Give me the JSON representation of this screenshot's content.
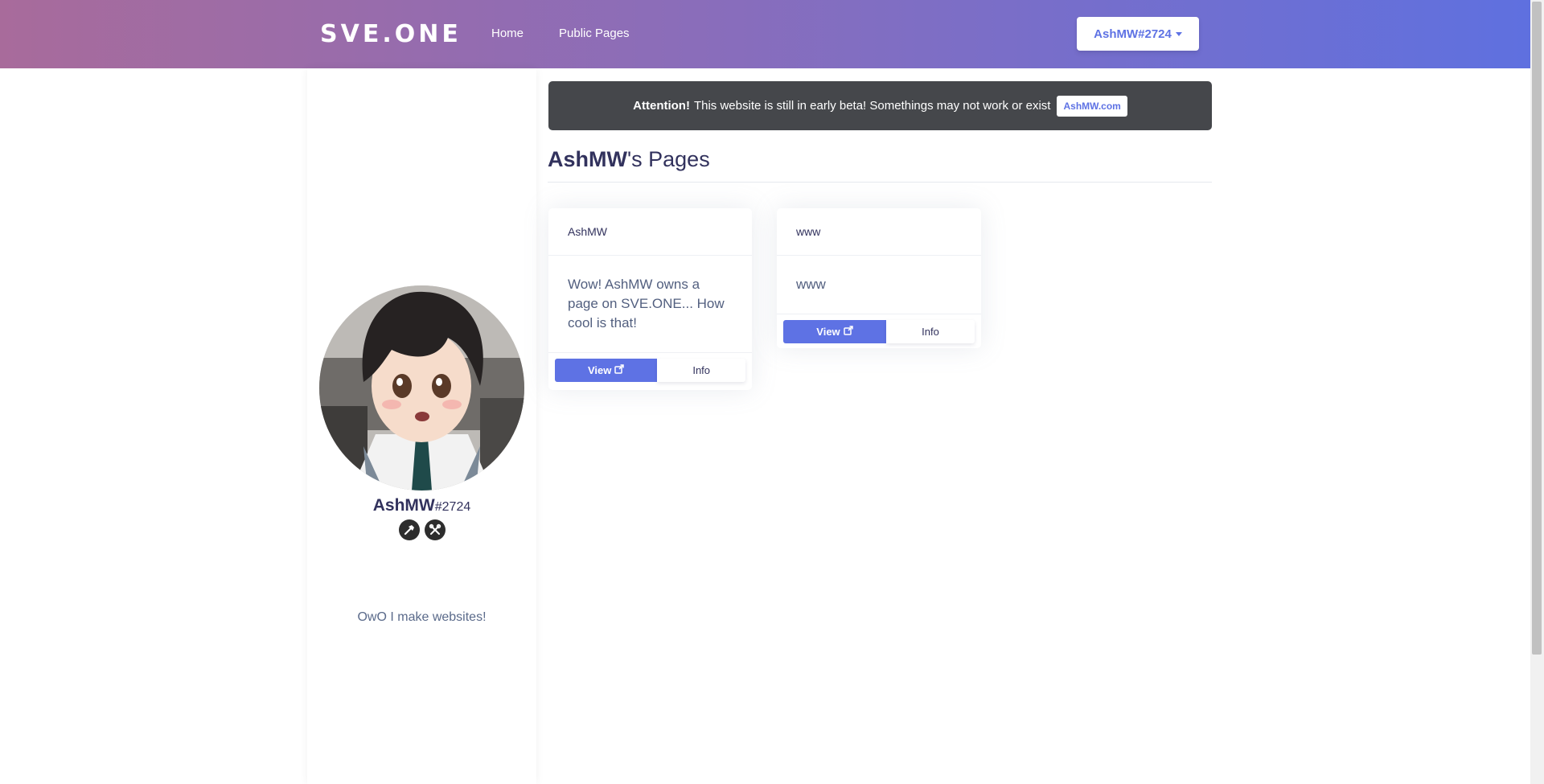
{
  "navbar": {
    "brand": "SVE.ONE",
    "links": [
      "Home",
      "Public Pages"
    ],
    "user_button": "AshMW#2724"
  },
  "profile": {
    "username": "AshMW",
    "discriminator": "#2724",
    "badges": [
      "hammer-icon",
      "tools-icon"
    ],
    "bio": "OwO I make websites!"
  },
  "alert": {
    "strong": "Attention!",
    "message": "This website is still in early beta! Somethings may not work or exist",
    "link_label": "AshMW.com"
  },
  "page": {
    "title_owner": "AshMW",
    "title_suffix": "'s Pages"
  },
  "cards": [
    {
      "header": "AshMW",
      "body": "Wow! AshMW owns a page on SVE.ONE... How cool is that!",
      "view_label": "View",
      "info_label": "Info"
    },
    {
      "header": "www",
      "body": "www",
      "view_label": "View",
      "info_label": "Info"
    }
  ],
  "colors": {
    "accent": "#5e72e4",
    "alert_bg": "#45474b",
    "nav_gradient_start": "#a86b9b",
    "nav_gradient_end": "#5e70e0"
  }
}
